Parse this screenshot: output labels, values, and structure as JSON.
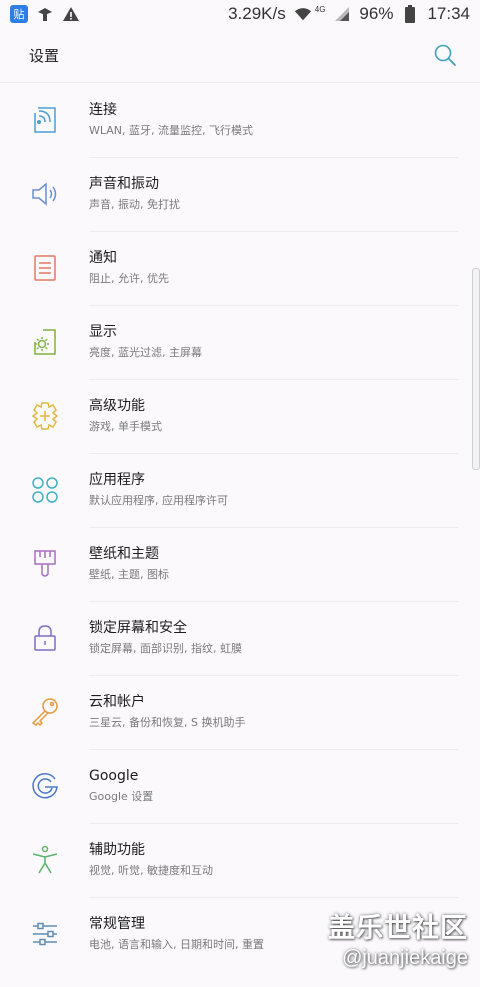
{
  "status_bar": {
    "notif_tieba": "贴",
    "speed": "3.29K/s",
    "network": "4G",
    "battery": "96%",
    "time": "17:34"
  },
  "header": {
    "title": "设置"
  },
  "items": [
    {
      "title": "连接",
      "subtitle": "WLAN, 蓝牙, 流量监控, 飞行模式",
      "icon": "connections-icon",
      "color": "#4a9fd0"
    },
    {
      "title": "声音和振动",
      "subtitle": "声音, 振动, 免打扰",
      "icon": "speaker-icon",
      "color": "#6a8fd0"
    },
    {
      "title": "通知",
      "subtitle": "阻止, 允许, 优先",
      "icon": "notification-icon",
      "color": "#e07a63"
    },
    {
      "title": "显示",
      "subtitle": "亮度, 蓝光过滤, 主屏幕",
      "icon": "display-icon",
      "color": "#7fb040"
    },
    {
      "title": "高级功能",
      "subtitle": "游戏, 单手模式",
      "icon": "advanced-gear-icon",
      "color": "#e3b83b"
    },
    {
      "title": "应用程序",
      "subtitle": "默认应用程序, 应用程序许可",
      "icon": "apps-icon",
      "color": "#3fb3c4"
    },
    {
      "title": "壁纸和主题",
      "subtitle": "壁纸, 主题, 图标",
      "icon": "brush-icon",
      "color": "#a86fc0"
    },
    {
      "title": "锁定屏幕和安全",
      "subtitle": "锁定屏幕, 面部识别, 指纹, 虹膜",
      "icon": "lock-icon",
      "color": "#7d6fc2"
    },
    {
      "title": "云和帐户",
      "subtitle": "三星云, 备份和恢复, S 换机助手",
      "icon": "key-icon",
      "color": "#e69a3f"
    },
    {
      "title": "Google",
      "subtitle": "Google 设置",
      "icon": "google-icon",
      "color": "#4a78c8"
    },
    {
      "title": "辅助功能",
      "subtitle": "视觉, 听觉, 敏捷度和互动",
      "icon": "accessibility-icon",
      "color": "#5db36a"
    },
    {
      "title": "常规管理",
      "subtitle": "电池, 语言和输入, 日期和时间, 重置",
      "icon": "sliders-icon",
      "color": "#5f8db5"
    }
  ],
  "watermark": {
    "title": "盖乐世社区",
    "handle": "@juanjiekaige"
  },
  "colors": {
    "background": "#fbf9fc",
    "search_accent": "#3fa3b8"
  }
}
